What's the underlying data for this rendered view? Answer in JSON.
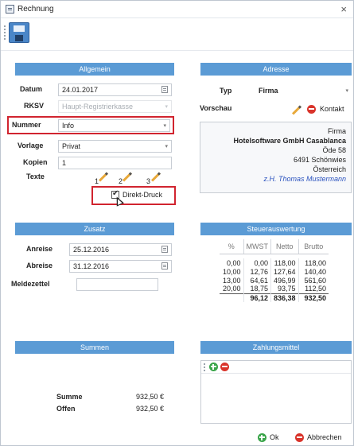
{
  "window": {
    "title": "Rechnung",
    "close": "×"
  },
  "sections": {
    "allgemein": "Allgemein",
    "adresse": "Adresse",
    "zusatz": "Zusatz",
    "steuer": "Steuerauswertung",
    "summen": "Summen",
    "zahlung": "Zahlungsmittel"
  },
  "allgemein": {
    "datum_label": "Datum",
    "datum_value": "24.01.2017",
    "rksv_label": "RKSV",
    "rksv_value": "Haupt-Registrierkasse",
    "nummer_label": "Nummer",
    "nummer_value": "Info",
    "vorlage_label": "Vorlage",
    "vorlage_value": "Privat",
    "kopien_label": "Kopien",
    "kopien_value": "1",
    "texte_label": "Texte",
    "texte_nums": [
      "1",
      "2",
      "3"
    ],
    "direkt_druck": "Direkt-Druck"
  },
  "adresse": {
    "typ_label": "Typ",
    "typ_value": "Firma",
    "vorschau_label": "Vorschau",
    "kontakt_button": "Kontakt",
    "lines": {
      "type": "Firma",
      "company": "Hotelsoftware GmbH Casablanca",
      "street": "Öde 58",
      "city": "6491 Schönwies",
      "country": "Österreich",
      "attn": "z.H. Thomas Mustermann"
    }
  },
  "zusatz": {
    "anreise_label": "Anreise",
    "anreise_value": "25.12.2016",
    "abreise_label": "Abreise",
    "abreise_value": "31.12.2016",
    "meldezettel_label": "Meldezettel",
    "meldezettel_value": ""
  },
  "steuer": {
    "headers": [
      "%",
      "MWST",
      "Netto",
      "Brutto"
    ],
    "rows": [
      [
        "0,00",
        "0,00",
        "118,00",
        "118,00"
      ],
      [
        "10,00",
        "12,76",
        "127,64",
        "140,40"
      ],
      [
        "13,00",
        "64,61",
        "496,99",
        "561,60"
      ],
      [
        "20,00",
        "18,75",
        "93,75",
        "112,50"
      ]
    ],
    "total": [
      "",
      "96,12",
      "836,38",
      "932,50"
    ]
  },
  "summen": {
    "summe_label": "Summe",
    "summe_value": "932,50 €",
    "offen_label": "Offen",
    "offen_value": "932,50 €"
  },
  "footer": {
    "ok": "Ok",
    "abbrechen": "Abbrechen"
  },
  "colors": {
    "section_header": "#5b9bd5",
    "highlight": "#d1242f",
    "attn_text": "#2a52be"
  }
}
